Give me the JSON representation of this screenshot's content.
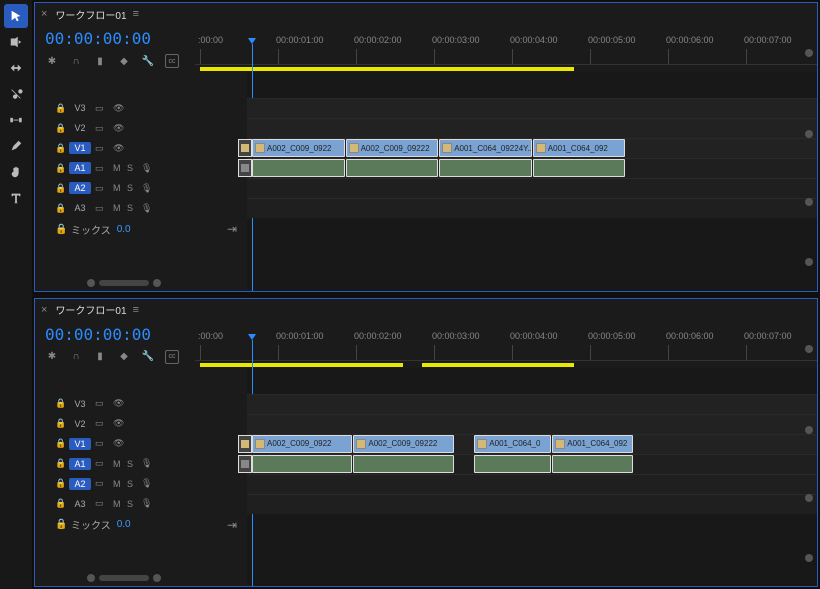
{
  "tools": [
    "selection",
    "ripple",
    "rate",
    "razor",
    "slip",
    "pen",
    "hand",
    "type"
  ],
  "active_tool": 0,
  "panels": [
    {
      "tab_title": "ワークフロー01",
      "timecode": "00:00:00:00",
      "ruler_ticks": [
        ":00:00",
        "00:00:01:00",
        "00:00:02:00",
        "00:00:03:00",
        "00:00:04:00",
        "00:00:05:00",
        "00:00:06:00",
        "00:00:07:00"
      ],
      "work_area": {
        "start": 0,
        "end": 4.8,
        "split": null
      },
      "video_tracks": [
        {
          "name": "V3",
          "active": false
        },
        {
          "name": "V2",
          "active": false
        },
        {
          "name": "V1",
          "active": true
        }
      ],
      "audio_tracks": [
        {
          "name": "A1",
          "active": true,
          "ms": true,
          "mic": true
        },
        {
          "name": "A2",
          "active": true,
          "ms": true,
          "mic": true
        },
        {
          "name": "A3",
          "active": false,
          "ms": true,
          "mic": true
        }
      ],
      "mix": {
        "label": "ミックス",
        "value": "0.0"
      },
      "clips_v1": [
        {
          "label": "A002_C009_0922",
          "start": 0.0,
          "end": 1.2
        },
        {
          "label": "A002_C009_09222",
          "start": 1.2,
          "end": 2.4
        },
        {
          "label": "A001_C064_09224Y...",
          "start": 2.4,
          "end": 3.6
        },
        {
          "label": "A001_C064_092",
          "start": 3.6,
          "end": 4.8
        }
      ],
      "clips_a1": [
        {
          "start": 0.0,
          "end": 1.2
        },
        {
          "start": 1.2,
          "end": 2.4
        },
        {
          "start": 2.4,
          "end": 3.6
        },
        {
          "start": 3.6,
          "end": 4.8
        }
      ]
    },
    {
      "tab_title": "ワークフロー01",
      "timecode": "00:00:00:00",
      "ruler_ticks": [
        ":00:00",
        "00:00:01:00",
        "00:00:02:00",
        "00:00:03:00",
        "00:00:04:00",
        "00:00:05:00",
        "00:00:06:00",
        "00:00:07:00"
      ],
      "work_area": {
        "start": 0,
        "end": 4.8,
        "split": 2.6
      },
      "video_tracks": [
        {
          "name": "V3",
          "active": false
        },
        {
          "name": "V2",
          "active": false
        },
        {
          "name": "V1",
          "active": true
        }
      ],
      "audio_tracks": [
        {
          "name": "A1",
          "active": true,
          "ms": true,
          "mic": true
        },
        {
          "name": "A2",
          "active": true,
          "ms": true,
          "mic": true
        },
        {
          "name": "A3",
          "active": false,
          "ms": true,
          "mic": true
        }
      ],
      "mix": {
        "label": "ミックス",
        "value": "0.0"
      },
      "clips_v1": [
        {
          "label": "A002_C009_0922",
          "start": 0.0,
          "end": 1.3
        },
        {
          "label": "A002_C009_09222",
          "start": 1.3,
          "end": 2.6
        },
        {
          "label": "A001_C064_0",
          "start": 2.85,
          "end": 3.85
        },
        {
          "label": "A001_C064_092",
          "start": 3.85,
          "end": 4.9
        }
      ],
      "clips_a1": [
        {
          "start": 0.0,
          "end": 1.3
        },
        {
          "start": 1.3,
          "end": 2.6
        },
        {
          "start": 2.85,
          "end": 3.85
        },
        {
          "start": 3.85,
          "end": 4.9
        }
      ]
    }
  ]
}
